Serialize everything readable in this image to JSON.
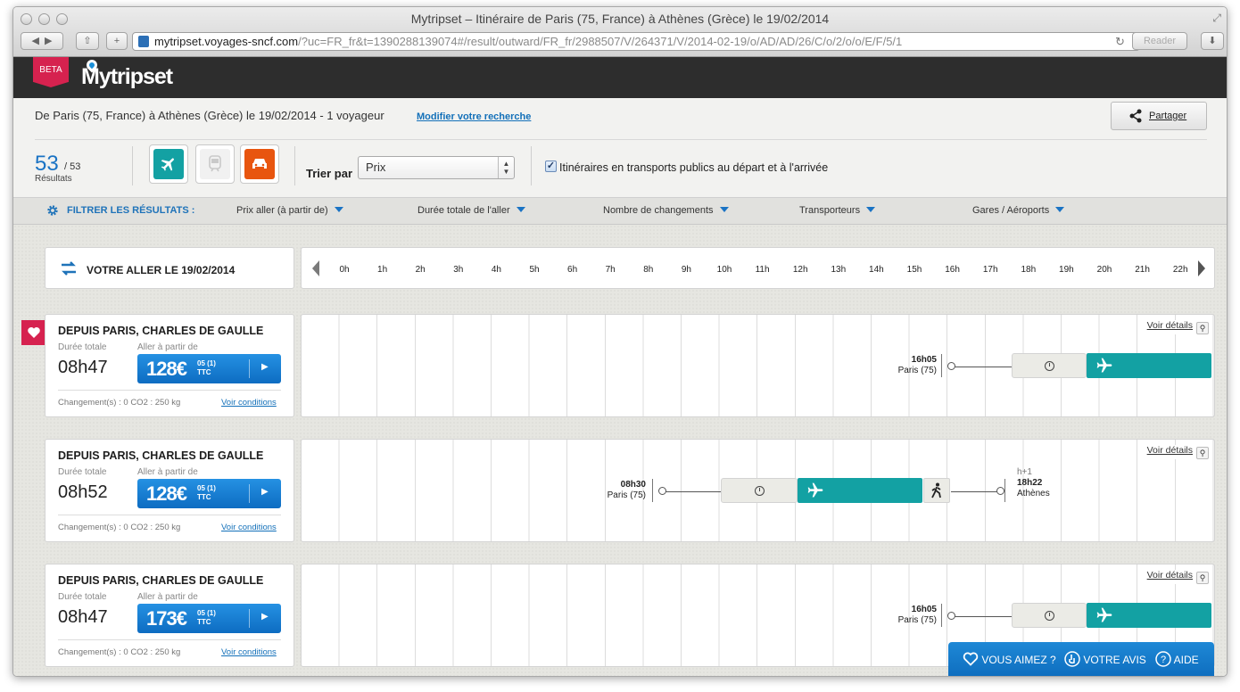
{
  "window": {
    "title": "Mytripset – Itinéraire de Paris (75, France) à Athènes (Grèce) le 19/02/2014"
  },
  "browser": {
    "url_domain": "mytripset.voyages-sncf.com",
    "url_path": "/?uc=FR_fr&t=1390288139074#/result/outward/FR_fr/2988507/V/264371/V/2014-02-19/o/AD/AD/26/C/o/2/o/o/E/F/5/1",
    "reader_label": "Reader"
  },
  "header": {
    "beta_label": "BETA",
    "logo_text": "Mytripset"
  },
  "search": {
    "summary": "De Paris (75, France) à Athènes (Grèce) le 19/02/2014 - 1 voyageur",
    "modify_label": "Modifier votre recherche",
    "share_label": "Partager"
  },
  "results": {
    "count": "53",
    "total": "/ 53",
    "label": "Résultats"
  },
  "sort": {
    "label": "Trier par",
    "value": "Prix"
  },
  "public_transport": {
    "label": "Itinéraires en transports publics au départ et à l'arrivée",
    "checked": "✓"
  },
  "filters": {
    "title": "FILTRER LES RÉSULTATS :",
    "items": [
      "Prix aller (à partir de)",
      "Durée totale de l'aller",
      "Nombre de changements",
      "Transporteurs",
      "Gares / Aéroports"
    ]
  },
  "direction": {
    "label": "VOTRE ALLER LE 19/02/2014"
  },
  "hours": [
    "0h",
    "1h",
    "2h",
    "3h",
    "4h",
    "5h",
    "6h",
    "7h",
    "8h",
    "9h",
    "10h",
    "11h",
    "12h",
    "13h",
    "14h",
    "15h",
    "16h",
    "17h",
    "18h",
    "19h",
    "20h",
    "21h",
    "22h"
  ],
  "labels": {
    "duration": "Durée totale",
    "price_from": "Aller à partir de",
    "ttc": "TTC",
    "conditions": "Voir conditions",
    "details": "Voir détails"
  },
  "itineraries": [
    {
      "origin": "DEPUIS PARIS, CHARLES DE GAULLE",
      "duration": "08h47",
      "price": "128€",
      "cents": "05 (1)",
      "info": "Changement(s) : 0   CO2 : 250 kg",
      "dep_time": "16h05",
      "dep_place": "Paris (75)"
    },
    {
      "origin": "DEPUIS PARIS, CHARLES DE GAULLE",
      "duration": "08h52",
      "price": "128€",
      "cents": "05 (1)",
      "info": "Changement(s) : 0   CO2 : 250 kg",
      "dep_time": "08h30",
      "dep_place": "Paris (75)",
      "arr_day": "h+1",
      "arr_time": "18h22",
      "arr_place": "Athènes"
    },
    {
      "origin": "DEPUIS PARIS, CHARLES DE GAULLE",
      "duration": "08h47",
      "price": "173€",
      "cents": "05 (1)",
      "info": "Changement(s) : 0   CO2 : 250 kg",
      "dep_time": "16h05",
      "dep_place": "Paris (75)"
    }
  ],
  "feedback": {
    "like": "VOUS AIMEZ ?",
    "review": "VOTRE AVIS",
    "help": "AIDE"
  },
  "colors": {
    "accent": "#1a73c4",
    "flight": "#13a1a3",
    "brand": "#d6224f",
    "car": "#e8550f"
  }
}
